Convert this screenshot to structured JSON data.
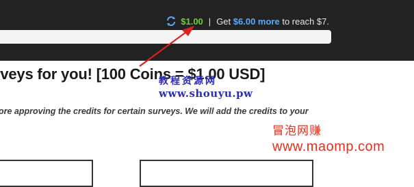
{
  "header": {
    "balance": "$1.00",
    "separator": "|",
    "goal_prefix": "Get",
    "goal_amount": "$6.00 more",
    "goal_suffix": "to reach $7.",
    "refresh_icon": "refresh-icon"
  },
  "main": {
    "heading": "rveys for you! [100 Coins = $1.00 USD]",
    "subtext": "ore approving the credits for certain surveys. We will add the credits to your"
  },
  "watermarks": {
    "site_cn": "教程资源网",
    "site_url": "www.shouyu.pw",
    "site2_cn": "冒泡网赚",
    "site2_url": "www.maomp.com"
  },
  "colors": {
    "topbar": "#222222",
    "balance_green": "#6fcf2f",
    "link_blue": "#5aa9ff",
    "watermark_blue": "#2d2db8",
    "watermark_red": "#e0301e"
  }
}
